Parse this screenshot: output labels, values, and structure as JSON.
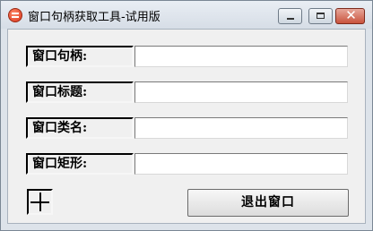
{
  "window": {
    "title": "窗口句柄获取工具-试用版",
    "close_glyph": "✕"
  },
  "fields": [
    {
      "label": "窗口句柄:",
      "value": ""
    },
    {
      "label": "窗口标题:",
      "value": ""
    },
    {
      "label": "窗口类名:",
      "value": ""
    },
    {
      "label": "窗口矩形:",
      "value": ""
    }
  ],
  "finder_icon": "crosshair-icon",
  "exit_button": {
    "label": "退出窗口"
  },
  "colors": {
    "client_bg": "#f0f0f0",
    "titlebar": "#dde3ea",
    "close_button": "#c9533d"
  }
}
